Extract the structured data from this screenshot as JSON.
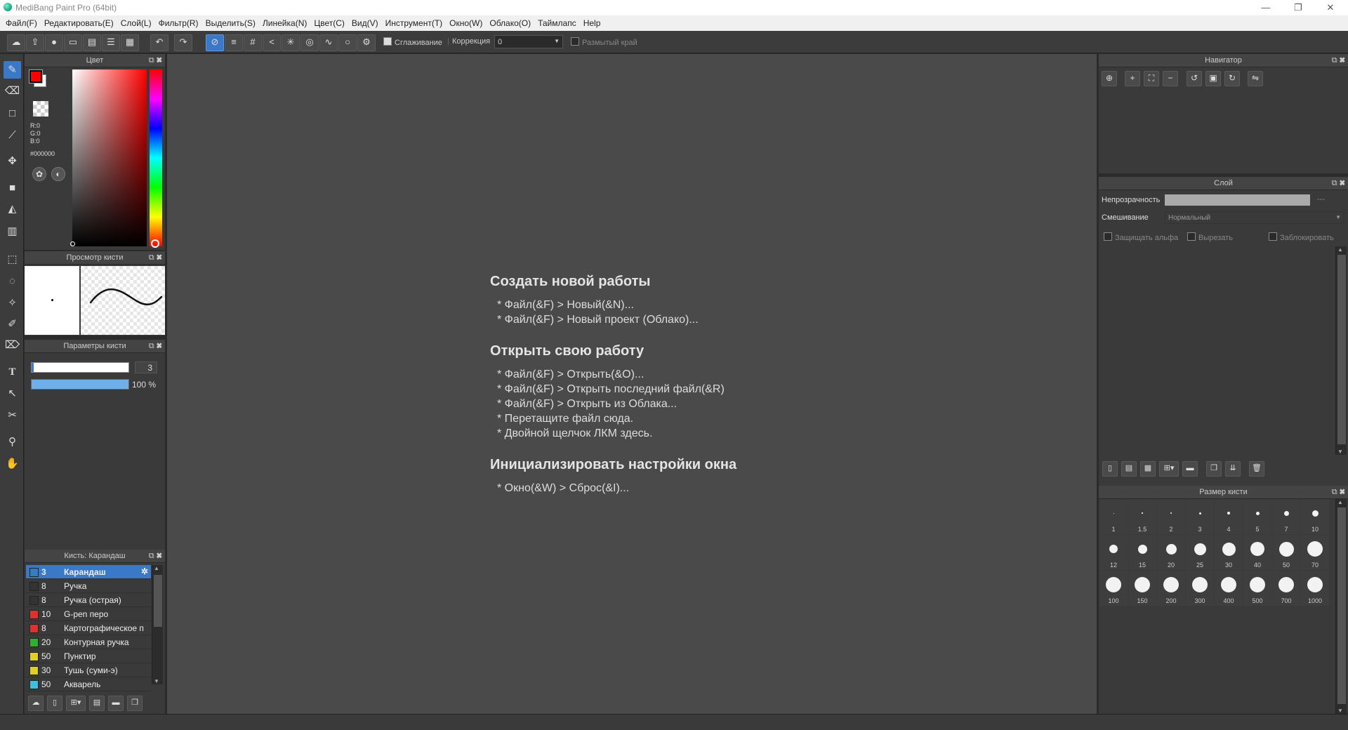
{
  "window": {
    "title": "MediBang Paint Pro (64bit)",
    "controls": {
      "minimize": "—",
      "maximize": "❐",
      "close": "✕"
    }
  },
  "menu": [
    "Файл(F)",
    "Редактировать(E)",
    "Слой(L)",
    "Фильтр(R)",
    "Выделить(S)",
    "Линейка(N)",
    "Цвет(C)",
    "Вид(V)",
    "Инструмент(T)",
    "Окно(W)",
    "Облако(O)",
    "Таймлапс",
    "Help"
  ],
  "toolbar": {
    "smoothing_label": "Сглаживание",
    "correction_label": "Коррекция",
    "correction_value": "0",
    "blur_edge_label": "Размытый край"
  },
  "color_panel": {
    "title": "Цвет",
    "r": "R:0",
    "g": "G:0",
    "b": "B:0",
    "hex": "#000000",
    "fg_color": "#ff0000",
    "bg_color": "#ffffff"
  },
  "brush_preview": {
    "title": "Просмотр кисти"
  },
  "brush_params": {
    "title": "Параметры кисти",
    "size_value": "3",
    "opacity_value": "100 %",
    "opacity_fraction": 1.0
  },
  "brush_list": {
    "title": "Кисть: Карандаш",
    "items": [
      {
        "size": "3",
        "name": "Карандаш",
        "color": "#3a78c8"
      },
      {
        "size": "8",
        "name": "Ручка",
        "color": "#333333"
      },
      {
        "size": "8",
        "name": "Ручка (острая)",
        "color": "#333333"
      },
      {
        "size": "10",
        "name": "G-pen перо",
        "color": "#e03030"
      },
      {
        "size": "8",
        "name": "Картографическое п",
        "color": "#e03030"
      },
      {
        "size": "20",
        "name": "Контурная ручка",
        "color": "#30b030"
      },
      {
        "size": "50",
        "name": "Пунктир",
        "color": "#e0d020"
      },
      {
        "size": "30",
        "name": "Тушь (суми-э)",
        "color": "#e0d020"
      },
      {
        "size": "50",
        "name": "Акварель",
        "color": "#40c0e0"
      }
    ]
  },
  "welcome": {
    "create_heading": "Создать новой работы",
    "create_lines": [
      "* Файл(&F) > Новый(&N)...",
      "* Файл(&F) > Новый проект (Облако)..."
    ],
    "open_heading": "Открыть свою работу",
    "open_lines": [
      "* Файл(&F) > Открыть(&O)...",
      "* Файл(&F) > Открыть последний файл(&R)",
      "* Файл(&F) > Открыть из Облака...",
      "* Перетащите файл сюда.",
      "* Двойной щелчок ЛКМ здесь."
    ],
    "init_heading": "Инициализировать настройки окна",
    "init_lines": [
      "* Окно(&W) > Сброс(&I)..."
    ]
  },
  "navigator": {
    "title": "Навигатор"
  },
  "layer": {
    "title": "Слой",
    "opacity_label": "Непрозрачность",
    "opacity_value": "---",
    "blend_label": "Смешивание",
    "blend_value": "Нормальный",
    "protect_alpha": "Защищать альфа",
    "clip": "Вырезать",
    "lock": "Заблокировать"
  },
  "brush_size": {
    "title": "Размер кисти",
    "sizes": [
      "1",
      "1.5",
      "2",
      "3",
      "4",
      "5",
      "7",
      "10",
      "12",
      "15",
      "20",
      "25",
      "30",
      "40",
      "50",
      "70",
      "100",
      "150",
      "200",
      "300",
      "400",
      "500",
      "700",
      "1000"
    ]
  }
}
